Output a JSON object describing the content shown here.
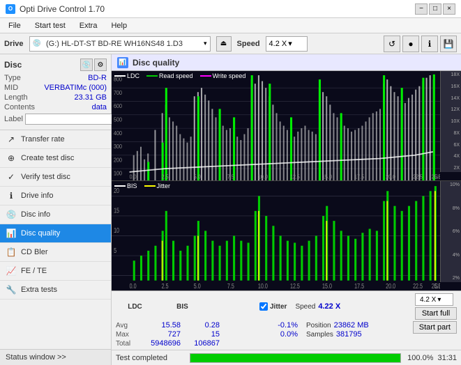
{
  "titlebar": {
    "icon": "O",
    "title": "Opti Drive Control 1.70",
    "minimize": "−",
    "maximize": "□",
    "close": "×"
  },
  "menu": {
    "items": [
      "File",
      "Start test",
      "Extra",
      "Help"
    ]
  },
  "drive_bar": {
    "label": "Drive",
    "drive_name": "(G:) HL-DT-ST BD-RE  WH16NS48 1.D3",
    "speed_label": "Speed",
    "speed_value": "4.2 X"
  },
  "sidebar": {
    "disc_header": "Disc",
    "disc_fields": [
      {
        "label": "Type",
        "value": "BD-R"
      },
      {
        "label": "MID",
        "value": "VERBATIMc (000)"
      },
      {
        "label": "Length",
        "value": "23.31 GB"
      },
      {
        "label": "Contents",
        "value": "data"
      },
      {
        "label": "Label",
        "value": ""
      }
    ],
    "nav_items": [
      {
        "label": "Transfer rate",
        "icon": "↗"
      },
      {
        "label": "Create test disc",
        "icon": "⊕"
      },
      {
        "label": "Verify test disc",
        "icon": "✓"
      },
      {
        "label": "Drive info",
        "icon": "ℹ"
      },
      {
        "label": "Disc info",
        "icon": "💿"
      },
      {
        "label": "Disc quality",
        "icon": "📊",
        "active": true
      },
      {
        "label": "CD Bler",
        "icon": "📋"
      },
      {
        "label": "FE / TE",
        "icon": "📈"
      },
      {
        "label": "Extra tests",
        "icon": "🔧"
      }
    ],
    "status_window": "Status window >>"
  },
  "panel": {
    "title": "Disc quality",
    "upper_chart": {
      "legend": [
        {
          "label": "LDC",
          "color": "#ffffff"
        },
        {
          "label": "Read speed",
          "color": "#00cc00"
        },
        {
          "label": "Write speed",
          "color": "#ff00ff"
        }
      ],
      "y_axis_right": [
        "18X",
        "16X",
        "14X",
        "12X",
        "10X",
        "8X",
        "6X",
        "4X",
        "2X"
      ],
      "y_axis_left_max": "800",
      "x_axis_max": "25.0 GB"
    },
    "lower_chart": {
      "legend": [
        {
          "label": "BIS",
          "color": "#ffffff"
        },
        {
          "label": "Jitter",
          "color": "#ffff00"
        }
      ],
      "y_axis_right": [
        "10%",
        "8%",
        "6%",
        "4%",
        "2%"
      ],
      "y_axis_left_max": "20"
    },
    "stats": {
      "columns": [
        "LDC",
        "BIS",
        "",
        "Jitter",
        "Speed",
        ""
      ],
      "avg": {
        "ldc": "15.58",
        "bis": "0.28",
        "jitter": "-0.1%"
      },
      "max": {
        "ldc": "727",
        "bis": "15",
        "jitter": "0.0%"
      },
      "total": {
        "ldc": "5948696",
        "bis": "106867"
      },
      "speed_value": "4.22 X",
      "position": "23862 MB",
      "samples": "381795",
      "speed_select": "4.2 X",
      "start_full": "Start full",
      "start_part": "Start part"
    }
  },
  "bottombar": {
    "status": "Test completed",
    "progress": 100,
    "progress_text": "100.0%",
    "time": "31:31"
  },
  "icons": {
    "disc": "💿",
    "settings": "⚙",
    "search": "🔍",
    "play": "▶",
    "save": "💾",
    "eject": "⏏",
    "refresh": "↺",
    "star": "★",
    "chart": "📊"
  }
}
